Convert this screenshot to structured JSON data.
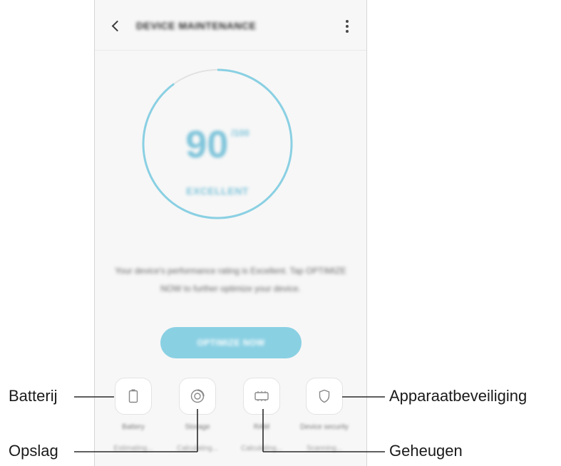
{
  "appbar": {
    "title": "DEVICE MAINTENANCE",
    "back_icon": "chevron-left-icon",
    "more_icon": "more-vertical-icon"
  },
  "score": {
    "value": "90",
    "max_label": "/100",
    "status": "EXCELLENT",
    "fraction": 0.9
  },
  "description": "Your device's performance rating is Excellent. Tap OPTIMIZE NOW to further optimize your device.",
  "optimize_button": {
    "label": "OPTIMIZE NOW"
  },
  "tiles": [
    {
      "name": "battery",
      "icon": "battery-icon",
      "label": "Battery",
      "sub": "Estimating..."
    },
    {
      "name": "storage",
      "icon": "storage-icon",
      "label": "Storage",
      "sub": "Calculating..."
    },
    {
      "name": "memory",
      "icon": "memory-icon",
      "label": "RAM",
      "sub": "Calculating..."
    },
    {
      "name": "security",
      "icon": "shield-icon",
      "label": "Device security",
      "sub": "Scanning..."
    }
  ],
  "callouts": {
    "battery": "Batterij",
    "storage": "Opslag",
    "memory": "Geheugen",
    "security": "Apparaatbeveiliging"
  },
  "colors": {
    "accent": "#8ad0e3",
    "gauge_arc": "#8ad0e3",
    "gauge_track": "#e2e2e2",
    "background": "#f7f7f7"
  }
}
